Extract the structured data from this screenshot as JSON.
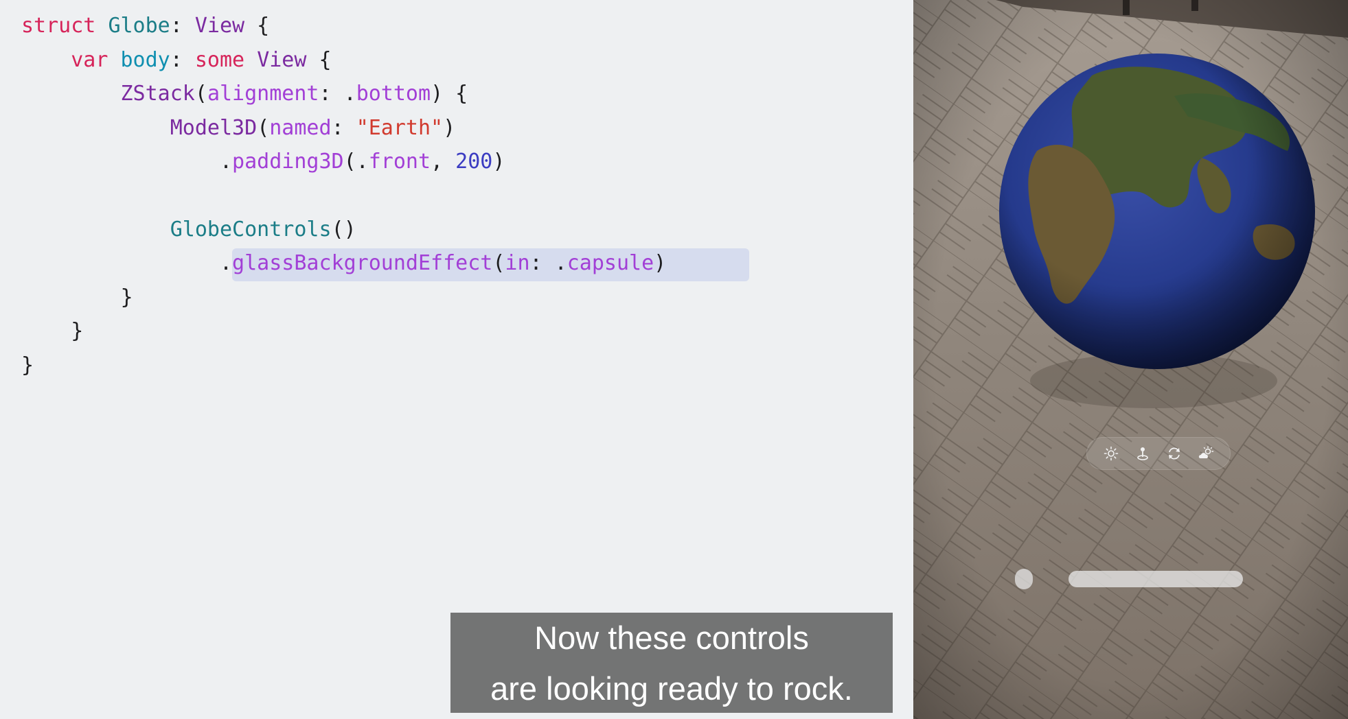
{
  "code": {
    "lines": [
      [
        {
          "t": "struct",
          "c": "kw"
        },
        {
          "t": " ",
          "c": "plain"
        },
        {
          "t": "Globe",
          "c": "type"
        },
        {
          "t": ": ",
          "c": "plain"
        },
        {
          "t": "View",
          "c": "type2"
        },
        {
          "t": " {",
          "c": "plain"
        }
      ],
      [
        {
          "t": "    ",
          "c": "plain"
        },
        {
          "t": "var",
          "c": "kw"
        },
        {
          "t": " ",
          "c": "plain"
        },
        {
          "t": "body",
          "c": "prop"
        },
        {
          "t": ": ",
          "c": "plain"
        },
        {
          "t": "some",
          "c": "kw"
        },
        {
          "t": " ",
          "c": "plain"
        },
        {
          "t": "View",
          "c": "type2"
        },
        {
          "t": " {",
          "c": "plain"
        }
      ],
      [
        {
          "t": "        ",
          "c": "plain"
        },
        {
          "t": "ZStack",
          "c": "type2"
        },
        {
          "t": "(",
          "c": "plain"
        },
        {
          "t": "alignment",
          "c": "param"
        },
        {
          "t": ": .",
          "c": "plain"
        },
        {
          "t": "bottom",
          "c": "mod"
        },
        {
          "t": ") {",
          "c": "plain"
        }
      ],
      [
        {
          "t": "            ",
          "c": "plain"
        },
        {
          "t": "Model3D",
          "c": "type2"
        },
        {
          "t": "(",
          "c": "plain"
        },
        {
          "t": "named",
          "c": "param"
        },
        {
          "t": ": ",
          "c": "plain"
        },
        {
          "t": "\"Earth\"",
          "c": "str"
        },
        {
          "t": ")",
          "c": "plain"
        }
      ],
      [
        {
          "t": "                .",
          "c": "plain"
        },
        {
          "t": "padding3D",
          "c": "mod"
        },
        {
          "t": "(.",
          "c": "plain"
        },
        {
          "t": "front",
          "c": "mod"
        },
        {
          "t": ", ",
          "c": "plain"
        },
        {
          "t": "200",
          "c": "num"
        },
        {
          "t": ")",
          "c": "plain"
        }
      ],
      [],
      [
        {
          "t": "            ",
          "c": "plain"
        },
        {
          "t": "GlobeControls",
          "c": "type"
        },
        {
          "t": "()",
          "c": "plain"
        }
      ],
      [
        {
          "t": "                .",
          "c": "plain"
        },
        {
          "t": "glassBackgroundEffect",
          "c": "mod"
        },
        {
          "t": "(",
          "c": "plain"
        },
        {
          "t": "in",
          "c": "param"
        },
        {
          "t": ": .",
          "c": "plain"
        },
        {
          "t": "capsule",
          "c": "mod"
        },
        {
          "t": ")",
          "c": "plain"
        }
      ],
      [
        {
          "t": "        }",
          "c": "plain"
        }
      ],
      [
        {
          "t": "    }",
          "c": "plain"
        }
      ],
      [
        {
          "t": "}",
          "c": "plain"
        }
      ]
    ]
  },
  "preview": {
    "controls": [
      {
        "name": "sun-icon",
        "glyph": "☼"
      },
      {
        "name": "pin-icon",
        "glyph": "⍋"
      },
      {
        "name": "rotate-icon",
        "glyph": "⟳"
      },
      {
        "name": "cloud-sun-icon",
        "glyph": "☁"
      }
    ]
  },
  "caption": {
    "line1": "Now these controls",
    "line2": "are looking ready to rock."
  }
}
